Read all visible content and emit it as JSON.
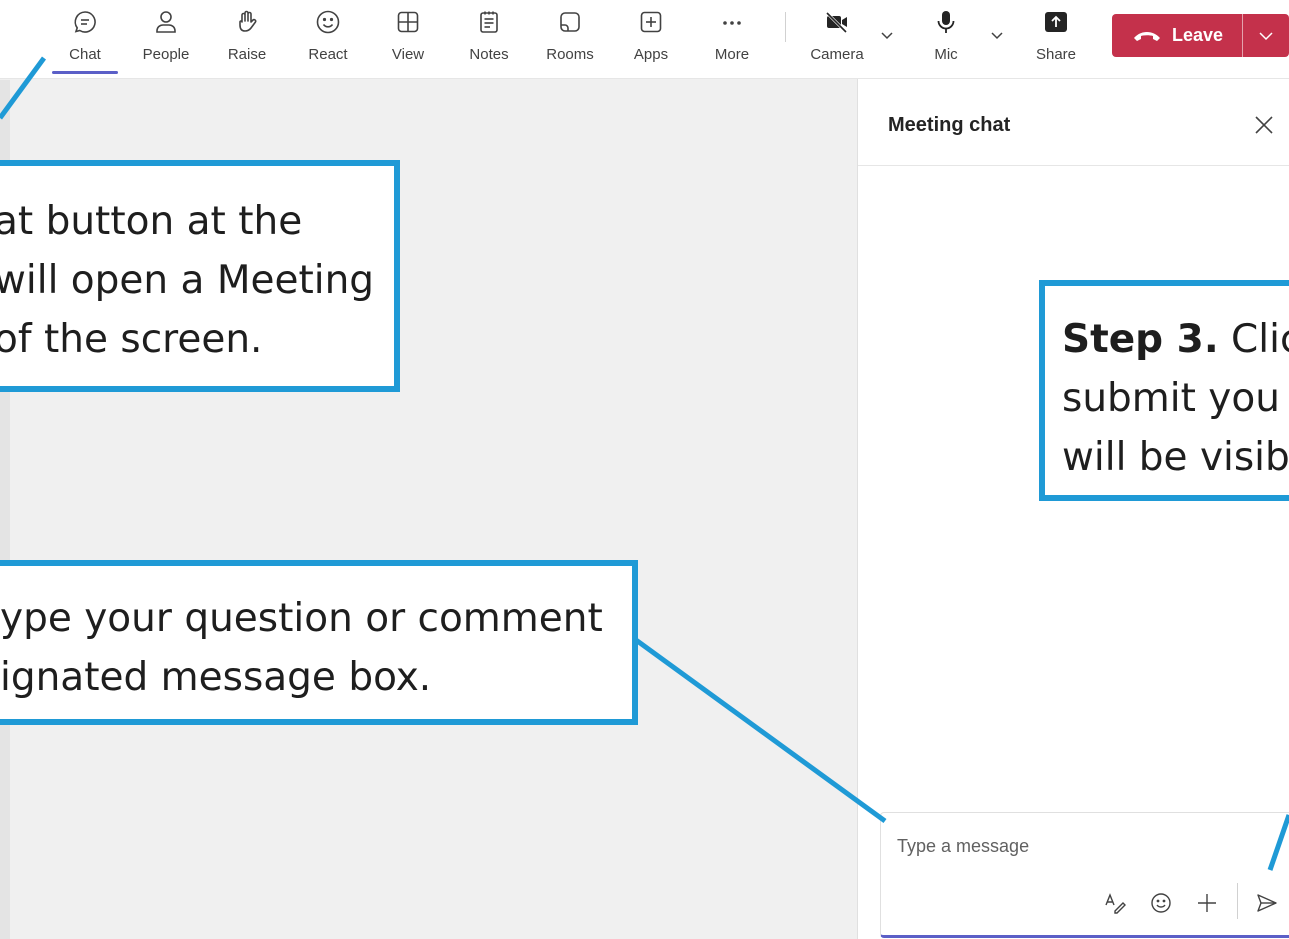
{
  "toolbar": {
    "buttons": [
      {
        "label": "Chat",
        "icon": "chat-icon",
        "active": true
      },
      {
        "label": "People",
        "icon": "people-icon"
      },
      {
        "label": "Raise",
        "icon": "raise-hand-icon"
      },
      {
        "label": "React",
        "icon": "react-smiley-icon"
      },
      {
        "label": "View",
        "icon": "view-grid-icon"
      },
      {
        "label": "Notes",
        "icon": "notes-icon"
      },
      {
        "label": "Rooms",
        "icon": "rooms-icon"
      },
      {
        "label": "Apps",
        "icon": "apps-plus-icon"
      },
      {
        "label": "More",
        "icon": "more-dots-icon"
      },
      {
        "label": "Camera",
        "icon": "camera-off-icon"
      },
      {
        "label": "Mic",
        "icon": "mic-icon"
      },
      {
        "label": "Share",
        "icon": "share-icon"
      }
    ],
    "leave_label": "Leave"
  },
  "chat_panel": {
    "title": "Meeting chat",
    "compose_placeholder": "Type a message"
  },
  "callouts": {
    "step1": {
      "line1": "at button at the",
      "line2": "will open a Meeting",
      "line3": "of the screen."
    },
    "step2": {
      "line1": "ype your question or comment",
      "line2": "ignated message box."
    },
    "step3": {
      "prefix": "Step 3.",
      "line1_rest": " Clic",
      "line2": "submit you",
      "line3": "will be visib"
    }
  },
  "colors": {
    "accent": "#5b5fc7",
    "leave": "#c4314b",
    "callout_border": "#1f9ad6",
    "stage_bg": "#f0f0f0"
  }
}
